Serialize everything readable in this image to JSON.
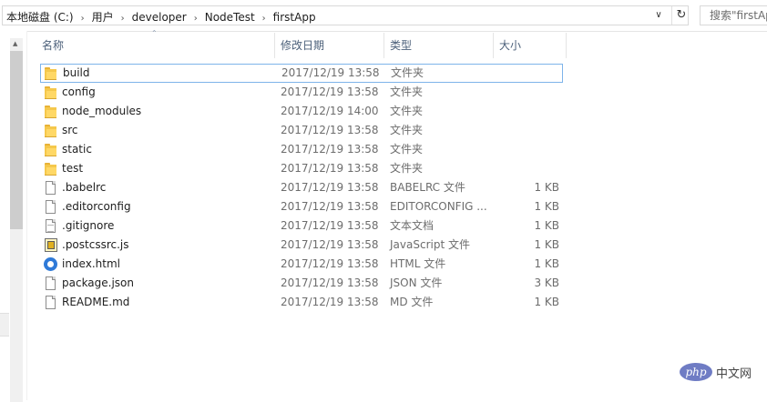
{
  "address_bar": {
    "crumbs": [
      "本地磁盘 (C:)",
      "用户",
      "developer",
      "NodeTest",
      "firstApp"
    ],
    "dropdown_glyph": "∨",
    "refresh_glyph": "↻",
    "search_placeholder": "搜索\"firstApp\""
  },
  "columns": {
    "name": "名称",
    "date": "修改日期",
    "type": "类型",
    "size": "大小"
  },
  "files": [
    {
      "name": "build",
      "date": "2017/12/19 13:58",
      "type": "文件夹",
      "size": "",
      "icon": "folder-icon",
      "selected": true
    },
    {
      "name": "config",
      "date": "2017/12/19 13:58",
      "type": "文件夹",
      "size": "",
      "icon": "folder-icon"
    },
    {
      "name": "node_modules",
      "date": "2017/12/19 14:00",
      "type": "文件夹",
      "size": "",
      "icon": "folder-icon"
    },
    {
      "name": "src",
      "date": "2017/12/19 13:58",
      "type": "文件夹",
      "size": "",
      "icon": "folder-icon"
    },
    {
      "name": "static",
      "date": "2017/12/19 13:58",
      "type": "文件夹",
      "size": "",
      "icon": "folder-icon"
    },
    {
      "name": "test",
      "date": "2017/12/19 13:58",
      "type": "文件夹",
      "size": "",
      "icon": "folder-icon"
    },
    {
      "name": ".babelrc",
      "date": "2017/12/19 13:58",
      "type": "BABELRC 文件",
      "size": "1 KB",
      "icon": "file-icon"
    },
    {
      "name": ".editorconfig",
      "date": "2017/12/19 13:58",
      "type": "EDITORCONFIG ...",
      "size": "1 KB",
      "icon": "file-icon"
    },
    {
      "name": ".gitignore",
      "date": "2017/12/19 13:58",
      "type": "文本文档",
      "size": "1 KB",
      "icon": "text-file-icon"
    },
    {
      "name": ".postcssrc.js",
      "date": "2017/12/19 13:58",
      "type": "JavaScript 文件",
      "size": "1 KB",
      "icon": "javascript-file-icon"
    },
    {
      "name": "index.html",
      "date": "2017/12/19 13:58",
      "type": "HTML 文件",
      "size": "1 KB",
      "icon": "html-file-icon"
    },
    {
      "name": "package.json",
      "date": "2017/12/19 13:58",
      "type": "JSON 文件",
      "size": "3 KB",
      "icon": "file-icon"
    },
    {
      "name": "README.md",
      "date": "2017/12/19 13:58",
      "type": "MD 文件",
      "size": "1 KB",
      "icon": "file-icon"
    }
  ],
  "watermark": {
    "logo_text": "php",
    "text": "中文网"
  },
  "colors": {
    "header_text": "#4c607a",
    "selection_border": "#7eb4ea",
    "folder": "#f5c84c",
    "detail_text": "#6d6d6d"
  }
}
